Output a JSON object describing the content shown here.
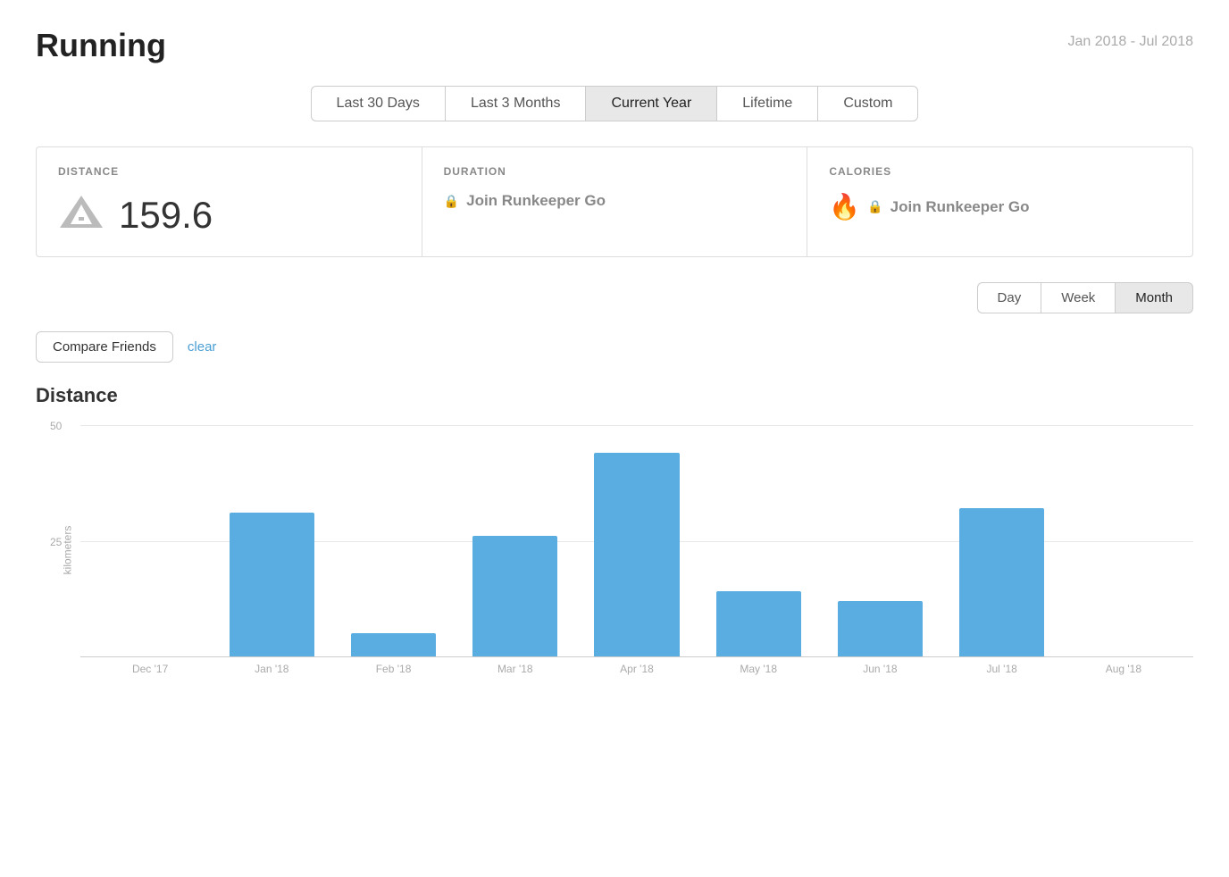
{
  "header": {
    "title": "Running",
    "date_range": "Jan 2018 - Jul 2018"
  },
  "time_filters": {
    "buttons": [
      {
        "label": "Last 30 Days",
        "active": false
      },
      {
        "label": "Last 3 Months",
        "active": false
      },
      {
        "label": "Current Year",
        "active": true
      },
      {
        "label": "Lifetime",
        "active": false
      },
      {
        "label": "Custom",
        "active": false
      }
    ]
  },
  "stats": {
    "distance": {
      "label": "DISTANCE",
      "value": "159.6",
      "icon": "🔺"
    },
    "duration": {
      "label": "DURATION",
      "locked_text": "Join Runkeeper Go"
    },
    "calories": {
      "label": "CALORIES",
      "locked_text": "Join Runkeeper Go"
    }
  },
  "view_toggle": {
    "buttons": [
      {
        "label": "Day",
        "active": false
      },
      {
        "label": "Week",
        "active": false
      },
      {
        "label": "Month",
        "active": true
      }
    ]
  },
  "friends": {
    "compare_btn": "Compare Friends",
    "clear_link": "clear"
  },
  "chart": {
    "title": "Distance",
    "y_label": "kilometers",
    "grid_lines": [
      {
        "value": 50,
        "pct": 0
      },
      {
        "value": 25,
        "pct": 50
      }
    ],
    "max_value": 50,
    "bars": [
      {
        "label": "Dec '17",
        "value": 0
      },
      {
        "label": "Jan '18",
        "value": 31
      },
      {
        "label": "Feb '18",
        "value": 5
      },
      {
        "label": "Mar '18",
        "value": 26
      },
      {
        "label": "Apr '18",
        "value": 44
      },
      {
        "label": "May '18",
        "value": 14
      },
      {
        "label": "Jun '18",
        "value": 12
      },
      {
        "label": "Jul '18",
        "value": 32
      },
      {
        "label": "Aug '18",
        "value": 0
      }
    ]
  }
}
